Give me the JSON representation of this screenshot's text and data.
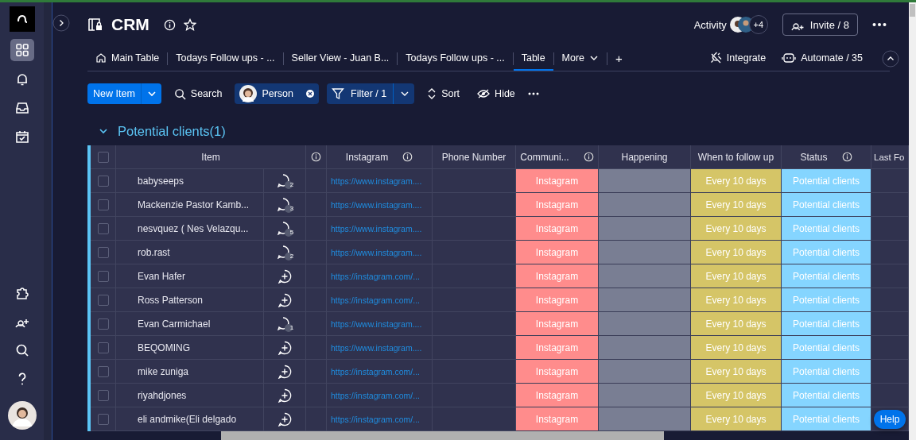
{
  "board": {
    "title": "CRM"
  },
  "activity": {
    "label": "Activity",
    "more": "+4"
  },
  "invite": "Invite / 8",
  "views": [
    {
      "label": "Main Table",
      "selected": false,
      "kind": "home"
    },
    {
      "label": "Todays Follow ups - ...",
      "selected": false,
      "kind": "plain"
    },
    {
      "label": "Seller View - Juan B...",
      "selected": false,
      "kind": "plain"
    },
    {
      "label": "Todays Follow ups - ...",
      "selected": false,
      "kind": "plain"
    },
    {
      "label": "Table",
      "selected": true,
      "kind": "plain"
    },
    {
      "label": "More",
      "selected": false,
      "kind": "more"
    }
  ],
  "add_view": "+",
  "integrate": "Integrate",
  "automate": "Automate / 35",
  "toolbar": {
    "new_item": "New Item",
    "search": "Search",
    "person": "Person",
    "filter": "Filter / 1",
    "sort": "Sort",
    "hide": "Hide"
  },
  "group": {
    "title": "Potential clients(1)",
    "expanded": true
  },
  "select_all": {
    "checked": false
  },
  "columns": [
    {
      "label": "Item",
      "info": false
    },
    {
      "info": true
    },
    {
      "label": "Instagram",
      "info": true
    },
    {
      "label": "Phone Number",
      "info": false
    },
    {
      "label": "Communi...",
      "info": true
    },
    {
      "label": "Happening",
      "info": false
    },
    {
      "label": "When to follow up",
      "info": false
    },
    {
      "label": "Status",
      "info": true
    },
    {
      "label": "Last Fo"
    }
  ],
  "rows": [
    {
      "name": "babyseeps",
      "checked": false,
      "updates": "2",
      "instagram": "https://www.instagram....",
      "communication": {
        "label": "Instagram",
        "color": "#ff8c8c"
      },
      "happening": {
        "color": "#797e93"
      },
      "follow_up": {
        "label": "Every 10 days",
        "color": "#d5c567"
      },
      "status": {
        "label": "Potential clients",
        "color": "#85d5ff"
      }
    },
    {
      "name": "Mackenzie Pastor Kamb...",
      "checked": false,
      "updates": "3",
      "instagram": "https://www.instagram....",
      "communication": {
        "label": "Instagram",
        "color": "#ff8c8c"
      },
      "happening": {
        "color": "#797e93"
      },
      "follow_up": {
        "label": "Every 10 days",
        "color": "#d5c567"
      },
      "status": {
        "label": "Potential clients",
        "color": "#85d5ff"
      }
    },
    {
      "name": "nesvquez ( Nes Velazqu...",
      "checked": false,
      "updates": "5",
      "instagram": "https://www.instagram....",
      "communication": {
        "label": "Instagram",
        "color": "#ff8c8c"
      },
      "happening": {
        "color": "#797e93"
      },
      "follow_up": {
        "label": "Every 10 days",
        "color": "#d5c567"
      },
      "status": {
        "label": "Potential clients",
        "color": "#85d5ff"
      }
    },
    {
      "name": "rob.rast",
      "checked": false,
      "updates": "2",
      "instagram": "https://www.instagram....",
      "communication": {
        "label": "Instagram",
        "color": "#ff8c8c"
      },
      "happening": {
        "color": "#797e93"
      },
      "follow_up": {
        "label": "Every 10 days",
        "color": "#d5c567"
      },
      "status": {
        "label": "Potential clients",
        "color": "#85d5ff"
      }
    },
    {
      "name": "Evan Hafer",
      "checked": false,
      "instagram": "https://instagram.com/...",
      "communication": {
        "label": "Instagram",
        "color": "#ff8c8c"
      },
      "happening": {
        "color": "#797e93"
      },
      "follow_up": {
        "label": "Every 10 days",
        "color": "#d5c567"
      },
      "status": {
        "label": "Potential clients",
        "color": "#85d5ff"
      }
    },
    {
      "name": "Ross Patterson",
      "checked": false,
      "instagram": "https://instagram.com/...",
      "communication": {
        "label": "Instagram",
        "color": "#ff8c8c"
      },
      "happening": {
        "color": "#797e93"
      },
      "follow_up": {
        "label": "Every 10 days",
        "color": "#d5c567"
      },
      "status": {
        "label": "Potential clients",
        "color": "#85d5ff"
      }
    },
    {
      "name": "Evan Carmichael",
      "checked": false,
      "updates": "1",
      "instagram": "https://www.instagram....",
      "communication": {
        "label": "Instagram",
        "color": "#ff8c8c"
      },
      "happening": {
        "color": "#797e93"
      },
      "follow_up": {
        "label": "Every 10 days",
        "color": "#d5c567"
      },
      "status": {
        "label": "Potential clients",
        "color": "#85d5ff"
      }
    },
    {
      "name": "BEQOMING",
      "checked": false,
      "instagram": "https://www.instagram....",
      "communication": {
        "label": "Instagram",
        "color": "#ff8c8c"
      },
      "happening": {
        "color": "#797e93"
      },
      "follow_up": {
        "label": "Every 10 days",
        "color": "#d5c567"
      },
      "status": {
        "label": "Potential clients",
        "color": "#85d5ff"
      }
    },
    {
      "name": "mike zuniga",
      "checked": false,
      "instagram": "https://instagram.com/...",
      "communication": {
        "label": "Instagram",
        "color": "#ff8c8c"
      },
      "happening": {
        "color": "#797e93"
      },
      "follow_up": {
        "label": "Every 10 days",
        "color": "#d5c567"
      },
      "status": {
        "label": "Potential clients",
        "color": "#85d5ff"
      }
    },
    {
      "name": "riyahdjones",
      "checked": false,
      "instagram": "https://instagram.com/...",
      "communication": {
        "label": "Instagram",
        "color": "#ff8c8c"
      },
      "happening": {
        "color": "#797e93"
      },
      "follow_up": {
        "label": "Every 10 days",
        "color": "#d5c567"
      },
      "status": {
        "label": "Potential clients",
        "color": "#85d5ff"
      }
    },
    {
      "name": "eli andmike(Eli delgado",
      "checked": false,
      "instagram": "https://instagram.com/...",
      "communication": {
        "label": "Instagram",
        "color": "#ff8c8c"
      },
      "happening": {
        "color": "#797e93"
      },
      "follow_up": {
        "label": "Every 10 days",
        "color": "#d5c567"
      },
      "status": {
        "label": "Potential clients",
        "color": "#85d5ff"
      }
    }
  ],
  "help": "Help"
}
